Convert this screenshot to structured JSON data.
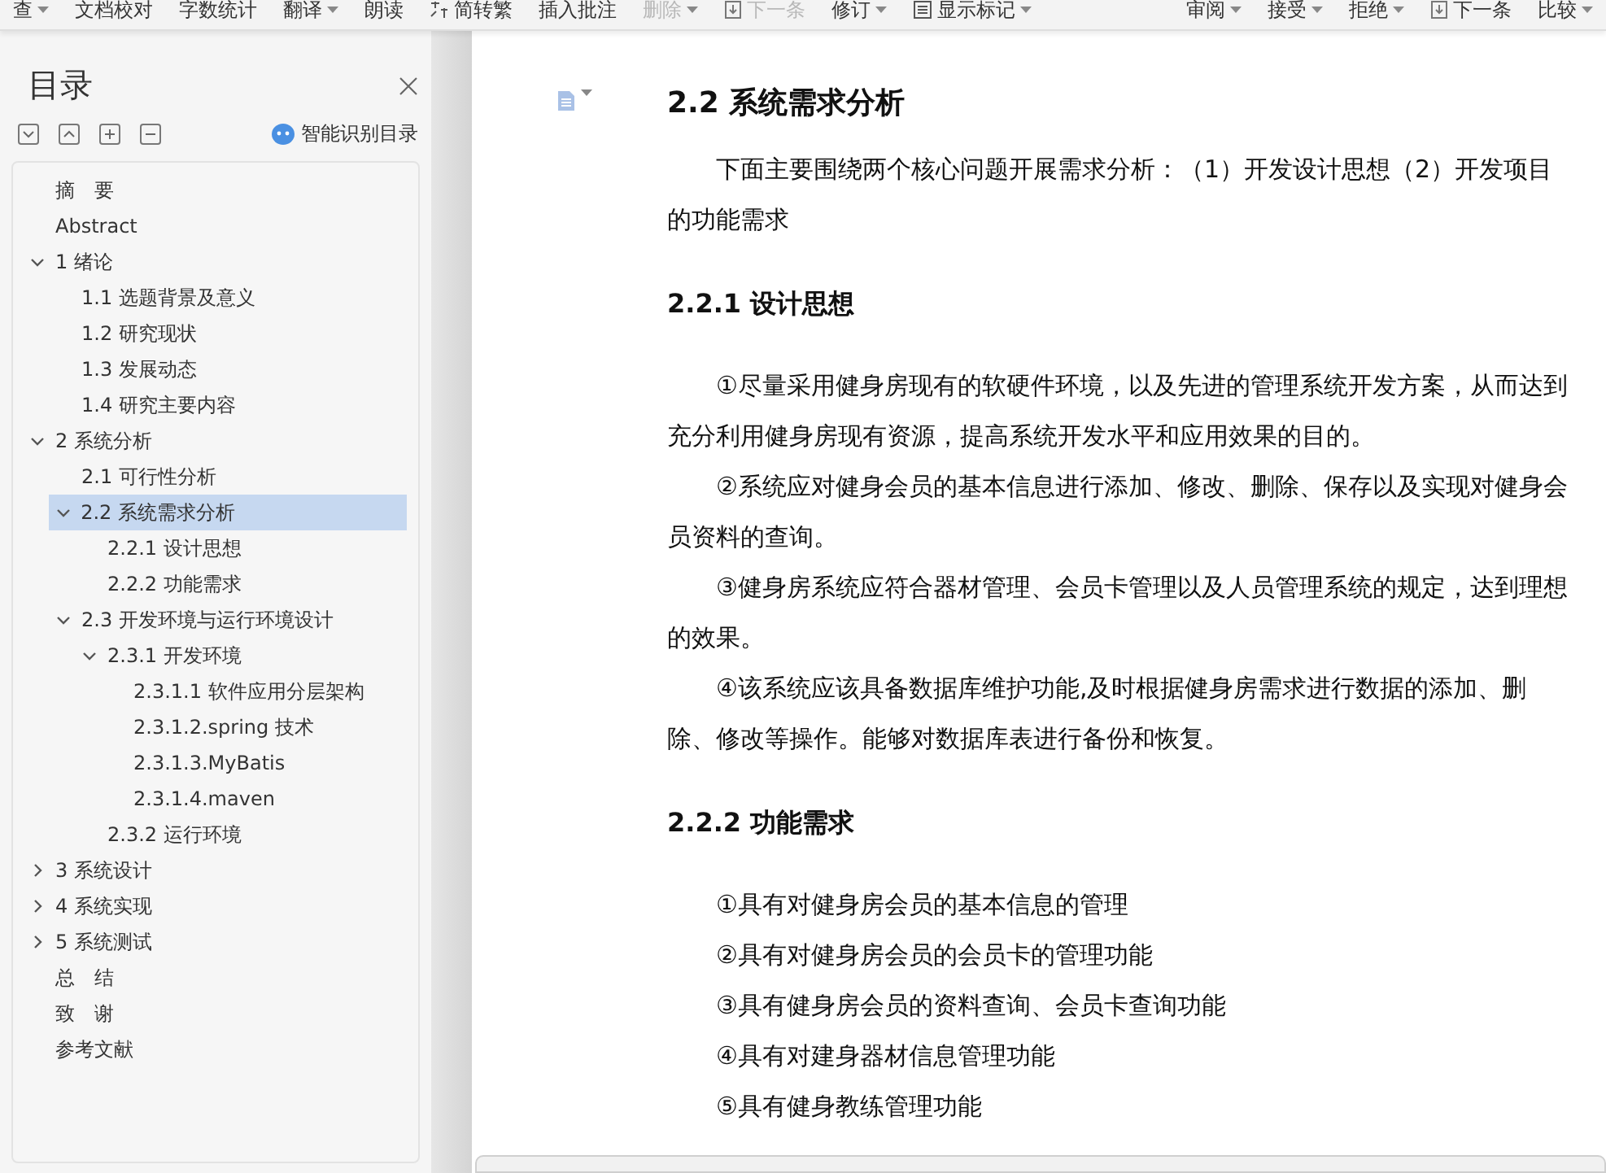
{
  "toolbar": {
    "left": [
      {
        "label": "查",
        "kind": "plain",
        "caret": true,
        "disabled": false
      },
      {
        "label": "文档校对",
        "kind": "plain",
        "caret": false,
        "disabled": false
      },
      {
        "label": "字数统计",
        "kind": "plain",
        "caret": false,
        "disabled": false
      },
      {
        "label": "翻译",
        "kind": "plain",
        "caret": true,
        "disabled": false
      },
      {
        "label": "朗读",
        "kind": "plain",
        "caret": false,
        "disabled": false
      },
      {
        "label": "简转繁",
        "kind": "convert",
        "caret": false,
        "disabled": false
      },
      {
        "label": "插入批注",
        "kind": "plain",
        "caret": false,
        "disabled": false
      },
      {
        "label": "删除",
        "kind": "plain",
        "caret": true,
        "disabled": true
      },
      {
        "label": "下一条",
        "kind": "next",
        "caret": false,
        "disabled": true
      },
      {
        "label": "修订",
        "kind": "plain",
        "caret": true,
        "disabled": false
      },
      {
        "label": "显示标记",
        "kind": "markup",
        "caret": true,
        "disabled": false
      }
    ],
    "right": [
      {
        "label": "审阅",
        "kind": "plain",
        "caret": true,
        "disabled": false
      },
      {
        "label": "接受",
        "kind": "plain",
        "caret": true,
        "disabled": false
      },
      {
        "label": "拒绝",
        "kind": "plain",
        "caret": true,
        "disabled": false
      },
      {
        "label": "下一条",
        "kind": "next",
        "caret": false,
        "disabled": false
      },
      {
        "label": "比较",
        "kind": "plain",
        "caret": true,
        "disabled": false
      }
    ]
  },
  "sidebar": {
    "title": "目录",
    "smart_button": "智能识别目录",
    "items": [
      {
        "label": "摘　要",
        "selected": false
      },
      {
        "label": "Abstract",
        "selected": false
      },
      {
        "label": "1 绪论",
        "selected": false,
        "expanded": true,
        "children": [
          {
            "label": "1.1 选题背景及意义",
            "selected": false
          },
          {
            "label": "1.2 研究现状",
            "selected": false
          },
          {
            "label": "1.3 发展动态",
            "selected": false
          },
          {
            "label": "1.4 研究主要内容",
            "selected": false
          }
        ]
      },
      {
        "label": "2 系统分析",
        "selected": false,
        "expanded": true,
        "children": [
          {
            "label": "2.1 可行性分析",
            "selected": false
          },
          {
            "label": "2.2  系统需求分析",
            "selected": true,
            "expanded": true,
            "children": [
              {
                "label": "2.2.1  设计思想",
                "selected": false
              },
              {
                "label": "2.2.2  功能需求",
                "selected": false
              }
            ]
          },
          {
            "label": "2.3  开发环境与运行环境设计",
            "selected": false,
            "expanded": true,
            "children": [
              {
                "label": "2.3.1  开发环境",
                "selected": false,
                "expanded": true,
                "children": [
                  {
                    "label": "2.3.1.1 软件应用分层架构",
                    "selected": false
                  },
                  {
                    "label": "2.3.1.2.spring 技术",
                    "selected": false
                  },
                  {
                    "label": "2.3.1.3.MyBatis",
                    "selected": false
                  },
                  {
                    "label": "2.3.1.4.maven",
                    "selected": false
                  }
                ]
              },
              {
                "label": "2.3.2  运行环境",
                "selected": false
              }
            ]
          }
        ]
      },
      {
        "label": "3 系统设计",
        "selected": false,
        "expanded": false
      },
      {
        "label": "4 系统实现",
        "selected": false,
        "expanded": false
      },
      {
        "label": "5 系统测试",
        "selected": false,
        "expanded": false
      },
      {
        "label": "总　结",
        "selected": false
      },
      {
        "label": "致　谢",
        "selected": false
      },
      {
        "label": "参考文献",
        "selected": false
      }
    ]
  },
  "document": {
    "blocks": [
      {
        "kind": "h2",
        "text": "2.2  系统需求分析"
      },
      {
        "kind": "p",
        "text": "下面主要围绕两个核心问题开展需求分析：（1）开发设计思想（2）开发项目的功能需求"
      },
      {
        "kind": "h3",
        "text": "2.2.1  设计思想"
      },
      {
        "kind": "p",
        "text": "①尽量采用健身房现有的软硬件环境，以及先进的管理系统开发方案，从而达到充分利用健身房现有资源，提高系统开发水平和应用效果的目的。"
      },
      {
        "kind": "p",
        "text": "②系统应对健身会员的基本信息进行添加、修改、删除、保存以及实现对健身会员资料的查询。"
      },
      {
        "kind": "p",
        "text": "③健身房系统应符合器材管理、会员卡管理以及人员管理系统的规定，达到理想的效果。"
      },
      {
        "kind": "p",
        "text": "④该系统应该具备数据库维护功能,及时根据健身房需求进行数据的添加、删除、修改等操作。能够对数据库表进行备份和恢复。"
      },
      {
        "kind": "h3",
        "text": "2.2.2  功能需求"
      },
      {
        "kind": "item",
        "text": "①具有对健身房会员的基本信息的管理"
      },
      {
        "kind": "item",
        "text": "②具有对健身房会员的会员卡的管理功能"
      },
      {
        "kind": "item",
        "text": "③具有健身房会员的资料查询、会员卡查询功能"
      },
      {
        "kind": "item",
        "text": "④具有对建身器材信息管理功能"
      },
      {
        "kind": "item",
        "text": "⑤具有健身教练管理功能"
      }
    ]
  }
}
